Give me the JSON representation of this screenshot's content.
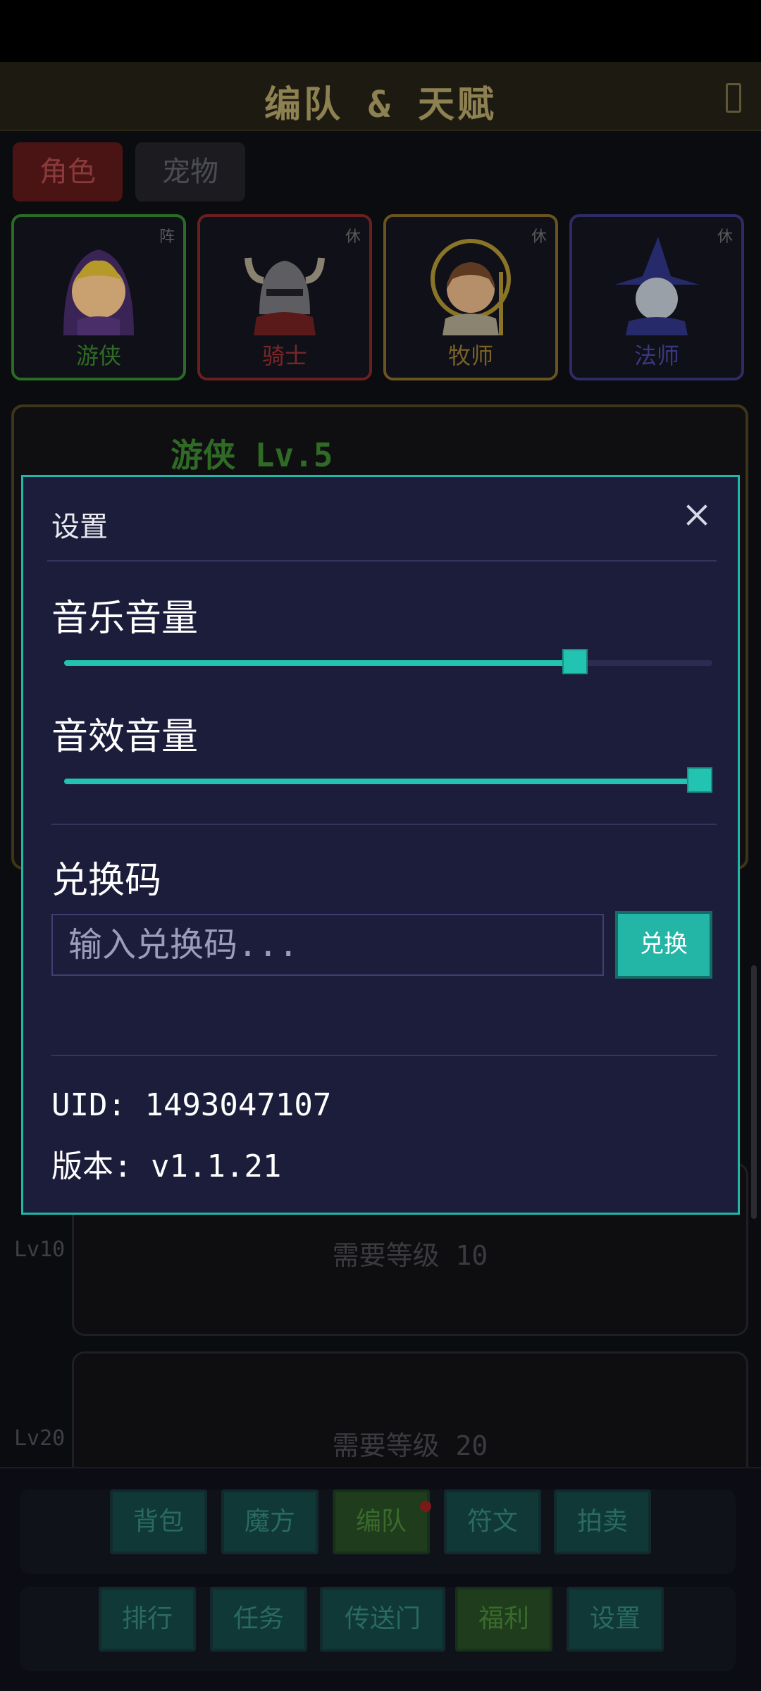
{
  "header": {
    "title": "编队 & 天赋"
  },
  "tabs": [
    {
      "label": "角色"
    },
    {
      "label": "宠物"
    }
  ],
  "characters": [
    {
      "name": "游侠",
      "badge": "阵",
      "color": "#2f8a2a"
    },
    {
      "name": "骑士",
      "badge": "休",
      "color": "#8a2323"
    },
    {
      "name": "牧师",
      "badge": "休",
      "color": "#8a6a1e"
    },
    {
      "name": "法师",
      "badge": "休",
      "color": "#3d3a8a"
    }
  ],
  "detail": {
    "name": "游侠 Lv.5"
  },
  "requirements": [
    {
      "level": "Lv10",
      "text": "需要等级 10"
    },
    {
      "level": "Lv20",
      "text": "需要等级 20"
    }
  ],
  "bottom_nav": {
    "row1": [
      "背包",
      "魔方",
      "编队",
      "符文",
      "拍卖"
    ],
    "row2": [
      "排行",
      "任务",
      "传送门",
      "福利",
      "设置"
    ]
  },
  "settings": {
    "title": "设置",
    "music_label": "音乐音量",
    "music_volume": 0.8,
    "sfx_label": "音效音量",
    "sfx_volume": 1.0,
    "code_label": "兑换码",
    "code_placeholder": "输入兑换码...",
    "redeem_label": "兑换",
    "uid_line": "UID: 1493047107",
    "version_line": "版本: v1.1.21"
  },
  "colors": {
    "accent": "#23c3b1",
    "modal_bg": "#1c1d3b"
  }
}
